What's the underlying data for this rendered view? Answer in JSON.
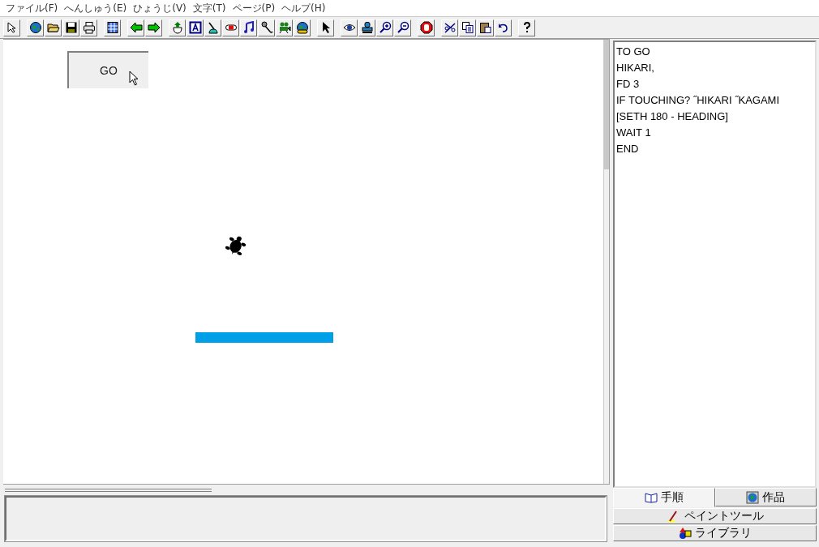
{
  "menu": [
    {
      "label": "ファイル(F)"
    },
    {
      "label": "へんしゅう(E)"
    },
    {
      "label": "ひょうじ(V)"
    },
    {
      "label": "文字(T)"
    },
    {
      "label": "ページ(P)"
    },
    {
      "label": "ヘルプ(H)"
    }
  ],
  "canvas": {
    "button": {
      "label": "GO"
    }
  },
  "procedure_editor": {
    "lines": [
      "TO GO",
      "HIKARI,",
      "FD 3",
      "IF TOUCHING? ˝HIKARI ˝KAGAMI",
      "[SETH 180 - HEADING]",
      "WAIT 1",
      "END"
    ]
  },
  "tabs": [
    {
      "label": "手順",
      "kind": "book",
      "selected": true
    },
    {
      "label": "作品",
      "kind": "globe",
      "selected": false
    },
    {
      "label": "ペイントツール",
      "kind": "brush",
      "selected": false
    },
    {
      "label": "ライブラリ",
      "kind": "shapes",
      "selected": false
    }
  ]
}
